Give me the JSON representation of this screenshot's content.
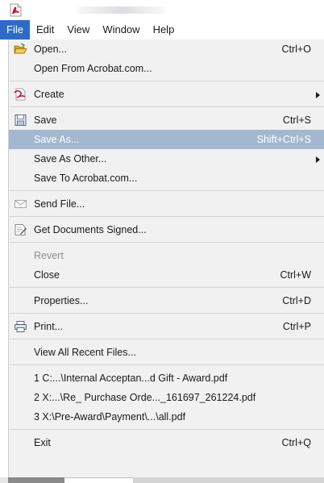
{
  "menubar": {
    "items": [
      {
        "label": "File",
        "active": true
      },
      {
        "label": "Edit"
      },
      {
        "label": "View"
      },
      {
        "label": "Window"
      },
      {
        "label": "Help"
      }
    ]
  },
  "file_menu": {
    "open": {
      "label": "Open...",
      "shortcut": "Ctrl+O",
      "icon": "folder-open-icon"
    },
    "open_from_acrobat": {
      "label": "Open From Acrobat.com..."
    },
    "create": {
      "label": "Create",
      "icon": "create-pdf-icon"
    },
    "save": {
      "label": "Save",
      "shortcut": "Ctrl+S",
      "icon": "floppy-disk-icon"
    },
    "save_as": {
      "label": "Save As...",
      "shortcut": "Shift+Ctrl+S"
    },
    "save_as_other": {
      "label": "Save As Other..."
    },
    "save_to_acrobat": {
      "label": "Save To Acrobat.com..."
    },
    "send_file": {
      "label": "Send File...",
      "icon": "envelope-icon"
    },
    "get_documents_signed": {
      "label": "Get Documents Signed...",
      "icon": "sign-document-icon"
    },
    "revert": {
      "label": "Revert"
    },
    "close": {
      "label": "Close",
      "shortcut": "Ctrl+W"
    },
    "properties": {
      "label": "Properties...",
      "shortcut": "Ctrl+D"
    },
    "print": {
      "label": "Print...",
      "shortcut": "Ctrl+P",
      "icon": "printer-icon"
    },
    "view_all_recent": {
      "label": "View All Recent Files..."
    },
    "recent_files": [
      "1 C:...\\Internal Acceptan...d Gift - Award.pdf",
      "2 X:...\\Re_ Purchase Orde..._161697_261224.pdf",
      "3 X:\\Pre-Award\\Payment\\...\\all.pdf"
    ],
    "exit": {
      "label": "Exit",
      "shortcut": "Ctrl+Q"
    }
  },
  "colors": {
    "menu_active": "#2e6bc6",
    "item_highlight": "#a3b8d0",
    "menu_background": "#f1f1f1",
    "acrobat_red": "#c8102e"
  }
}
